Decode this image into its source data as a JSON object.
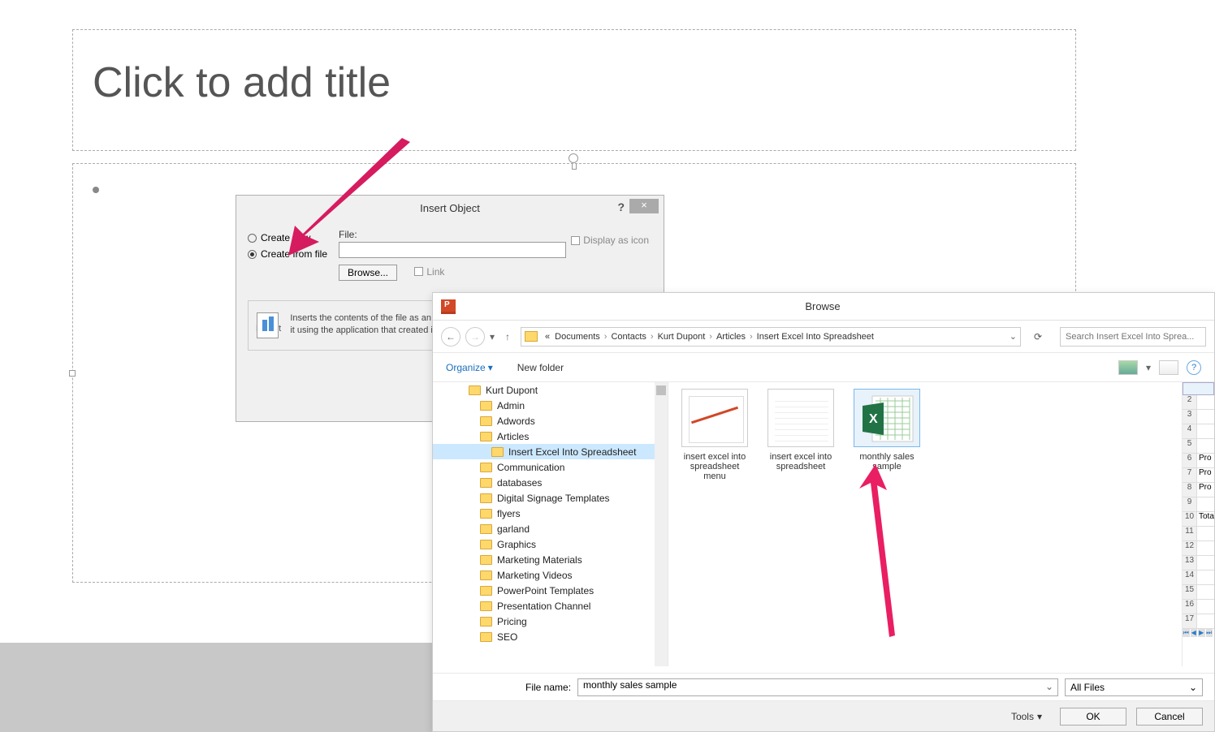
{
  "slide": {
    "title_placeholder": "Click to add title"
  },
  "insert_object": {
    "title": "Insert Object",
    "help": "?",
    "close": "×",
    "create_new": "Create new",
    "create_from_file": "Create from file",
    "file_label": "File:",
    "browse": "Browse...",
    "link": "Link",
    "display_as_icon": "Display as icon",
    "result_label": "Result",
    "result_text": "Inserts the contents of the file as an object into your presentation so that you can activate it using the application that created it."
  },
  "browse": {
    "title": "Browse",
    "breadcrumb": [
      "«",
      "Documents",
      "Contacts",
      "Kurt Dupont",
      "Articles",
      "Insert Excel Into Spreadsheet"
    ],
    "search_placeholder": "Search Insert Excel Into Sprea...",
    "organize": "Organize",
    "new_folder": "New folder",
    "tree": [
      {
        "label": "Kurt Dupont",
        "level": 0
      },
      {
        "label": "Admin",
        "level": 1
      },
      {
        "label": "Adwords",
        "level": 1
      },
      {
        "label": "Articles",
        "level": 1
      },
      {
        "label": "Insert Excel Into Spreadsheet",
        "level": 2,
        "selected": true
      },
      {
        "label": "Communication",
        "level": 1
      },
      {
        "label": "databases",
        "level": 1
      },
      {
        "label": "Digital Signage Templates",
        "level": 1
      },
      {
        "label": "flyers",
        "level": 1
      },
      {
        "label": "garland",
        "level": 1
      },
      {
        "label": "Graphics",
        "level": 1
      },
      {
        "label": "Marketing Materials",
        "level": 1
      },
      {
        "label": "Marketing Videos",
        "level": 1
      },
      {
        "label": "PowerPoint Templates",
        "level": 1
      },
      {
        "label": "Presentation Channel",
        "level": 1
      },
      {
        "label": "Pricing",
        "level": 1
      },
      {
        "label": "SEO",
        "level": 1
      }
    ],
    "files": [
      {
        "name": "insert excel into spreadsheet menu",
        "type": "ppt"
      },
      {
        "name": "insert excel into spreadsheet",
        "type": "sheet"
      },
      {
        "name": "monthly sales sample",
        "type": "excel",
        "selected": true
      }
    ],
    "preview_rows": [
      {
        "n": "2",
        "v": ""
      },
      {
        "n": "3",
        "v": ""
      },
      {
        "n": "4",
        "v": ""
      },
      {
        "n": "5",
        "v": ""
      },
      {
        "n": "6",
        "v": "Pro"
      },
      {
        "n": "7",
        "v": "Pro"
      },
      {
        "n": "8",
        "v": "Pro"
      },
      {
        "n": "9",
        "v": ""
      },
      {
        "n": "10",
        "v": "Tota"
      },
      {
        "n": "11",
        "v": ""
      },
      {
        "n": "12",
        "v": ""
      },
      {
        "n": "13",
        "v": ""
      },
      {
        "n": "14",
        "v": ""
      },
      {
        "n": "15",
        "v": ""
      },
      {
        "n": "16",
        "v": ""
      },
      {
        "n": "17",
        "v": ""
      }
    ],
    "file_name_label": "File name:",
    "file_name_value": "monthly sales sample",
    "filter": "All Files",
    "tools": "Tools",
    "ok": "OK",
    "cancel": "Cancel"
  }
}
